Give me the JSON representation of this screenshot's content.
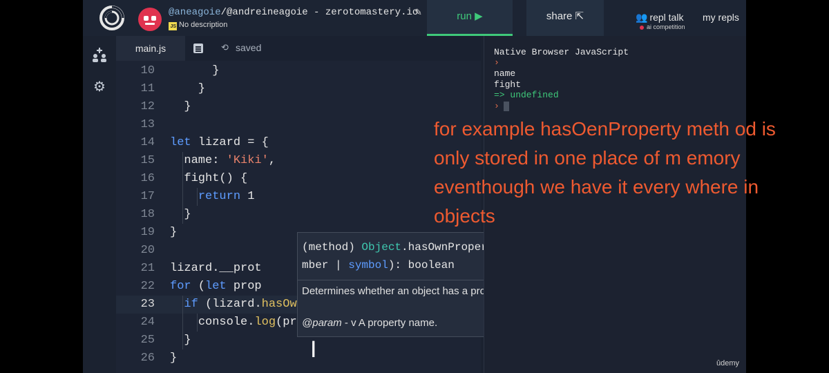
{
  "header": {
    "owner_handle": "@aneagoie",
    "repl_path_rest": "/@andreineagoie - zerotomastery.io",
    "edit_icon": "pencil-icon",
    "language_badge": "JS",
    "description": "No description",
    "run_label": "run ▶",
    "share_label": "share ⇱",
    "repl_talk_label": "repl talk",
    "ai_competition_label": "ai competition",
    "my_repls_label": "my repls"
  },
  "sidebar": {
    "icons": [
      "files-icon",
      "settings-gear-icon"
    ]
  },
  "editor": {
    "tab_label": "main.js",
    "saved_label": "saved",
    "code_lines": [
      {
        "n": "10",
        "html": "      }"
      },
      {
        "n": "11",
        "html": "    }"
      },
      {
        "n": "12",
        "html": "  }"
      },
      {
        "n": "13",
        "html": ""
      },
      {
        "n": "14",
        "html": "let lizard = {"
      },
      {
        "n": "15",
        "html": "  name: 'Kiki',"
      },
      {
        "n": "16",
        "html": "  fight() {"
      },
      {
        "n": "17",
        "html": "    return 1"
      },
      {
        "n": "18",
        "html": "  }"
      },
      {
        "n": "19",
        "html": "}"
      },
      {
        "n": "20",
        "html": ""
      },
      {
        "n": "21",
        "html": "lizard.__prot"
      },
      {
        "n": "22",
        "html": "for (let prop"
      },
      {
        "n": "23",
        "html": "  if (lizard.hasOwnProperty(prop)) {"
      },
      {
        "n": "24",
        "html": "    console.log(prop)"
      },
      {
        "n": "25",
        "html": "  }"
      },
      {
        "n": "26",
        "html": "}"
      }
    ]
  },
  "tooltip": {
    "signature_line1_a": "(method) ",
    "signature_line1_type": "Object",
    "signature_line1_b": ".hasOwnProperty(v: string | nu",
    "signature_line2_a": "mber | ",
    "signature_line2_sym": "symbol",
    "signature_line2_b": "): boolean",
    "description": "Determines whether an object has a property with the specified name.",
    "param_tag": "@param",
    "param_text": " - v A property name."
  },
  "console": {
    "title": "Native Browser JavaScript",
    "prompt": "›",
    "outputs": [
      "name",
      "fight"
    ],
    "result": "=> undefined",
    "watermark": "ûdemy"
  },
  "subtitle": {
    "text": "for example hasOenProperty meth od is only stored in one place of m emory eventhough we have it every where in objects"
  },
  "colors": {
    "run_accent": "#3fc97a",
    "subtitle": "#ee5a30",
    "keyword": "#5e9cff",
    "string": "#e8826b",
    "method": "#e0c060"
  }
}
